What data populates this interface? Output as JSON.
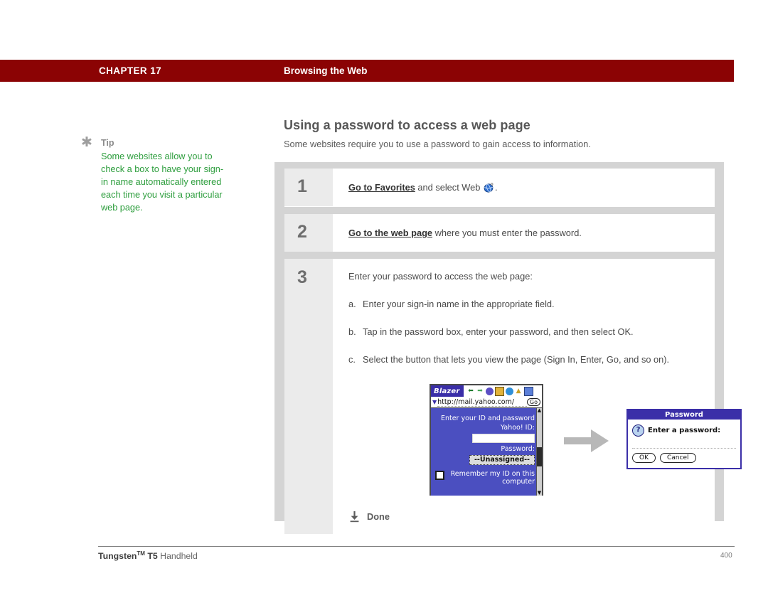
{
  "header": {
    "chapter_label": "CHAPTER 17",
    "section_label": "Browsing the Web",
    "bar_color": "#8b0304"
  },
  "tip": {
    "icon": "asterisk-icon",
    "title": "Tip",
    "body": "Some websites allow you to check a box to have your sign-in name automatically entered each time you visit a particular web page.",
    "text_color": "#2e9e3e",
    "title_color": "#8a8a8a"
  },
  "main": {
    "section_title": "Using a password to access a web page",
    "section_intro": "Some websites require you to use a password to gain access to information.",
    "steps": [
      {
        "number": "1",
        "lead": "Go to Favorites",
        "rest": " and select Web ",
        "icon": "web-globe-icon",
        "tail": "."
      },
      {
        "number": "2",
        "lead": "Go to the web page",
        "rest": " where you must enter the password.",
        "icon": null,
        "tail": ""
      },
      {
        "number": "3",
        "lead": "",
        "rest": "Enter your password to access the web page:",
        "icon": null,
        "tail": "",
        "substeps": [
          {
            "marker": "a.",
            "text": "Enter your sign-in name in the appropriate field."
          },
          {
            "marker": "b.",
            "text": "Tap in the password box, enter your password, and then select OK."
          },
          {
            "marker": "c.",
            "text": "Select the button that lets you view the page (Sign In, Enter, Go, and so on)."
          }
        ]
      }
    ],
    "done": {
      "icon": "done-down-arrow-icon",
      "label": "Done"
    }
  },
  "illustration": {
    "arrow_icon": "right-arrow-icon",
    "blazer": {
      "app_name": "Blazer",
      "toolbar_icons": [
        "back-arrow-icon",
        "forward-arrow-icon",
        "reload-icon",
        "bookmarks-icon",
        "globe-icon",
        "home-icon",
        "menu-grid-icon"
      ],
      "url_caret": "dropdown-caret-icon",
      "url": "http://mail.yahoo.com/",
      "go_label": "Go",
      "page": {
        "prompt": "Enter your ID and password",
        "id_label": "Yahoo! ID:",
        "id_value": "",
        "password_label": "Password:",
        "password_value": "--Unassigned--",
        "checkbox_label": "Remember my ID on this computer",
        "checkbox_checked": false
      },
      "screen_color": "#4b4fc0"
    },
    "dialog": {
      "title": "Password",
      "icon": "question-mark-icon",
      "prompt": "Enter a password:",
      "ok_label": "OK",
      "cancel_label": "Cancel",
      "title_color": "#3b2fa8"
    }
  },
  "footer": {
    "product_bold": "Tungsten",
    "product_tm": "TM",
    "product_model": " T5",
    "product_rest": " Handheld",
    "page_number": "400"
  }
}
